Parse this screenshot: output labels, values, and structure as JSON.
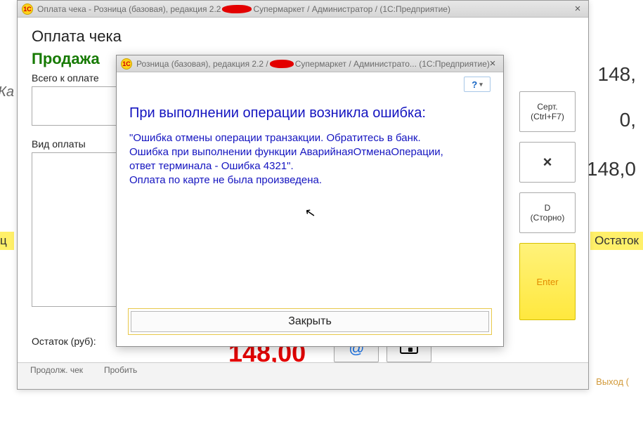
{
  "bg": {
    "left_text": "\"Ка",
    "row_left": "ц",
    "exit": "Выход (",
    "r1": "148,",
    "r2": "0,",
    "r3": "148,0",
    "ostatok": "Остаток"
  },
  "parent": {
    "title_prefix": "Оплата чека - Розница (базовая), редакция 2.2 ",
    "title_suffix": " Супермаркет / Администратор / (1С:Предприятие)",
    "heading": "Оплата чека",
    "sale": "Продажа",
    "total_label": "Всего к оплате",
    "paytype_label": "Вид оплаты",
    "remain_label": "Остаток (руб):",
    "remain_amount": "148,00",
    "at": "@",
    "side": {
      "cert_l1": "Серт.",
      "cert_l2": "(Ctrl+F7)",
      "x": "×",
      "d_l1": "D",
      "d_l2": "(Сторно)",
      "enter": "Enter"
    },
    "tabs": {
      "t1": "Продолж. чек",
      "t2a": "Пробить",
      "t2b": ""
    }
  },
  "modal": {
    "title_prefix": "Розница (базовая), редакция 2.2 / ",
    "title_suffix": "Супермаркет / Администрато... (1С:Предприятие)",
    "help": "?",
    "err_head": "При выполнении операции возникла ошибка:",
    "err_body1": "\"Ошибка отмены операции транзакции. Обратитесь в банк. Ошибка при выполнении функции АварийнаяОтменаОперации, ответ терминала - Ошибка 4321\".",
    "err_body2": "Оплата по карте не была произведена.",
    "close": "Закрыть"
  }
}
